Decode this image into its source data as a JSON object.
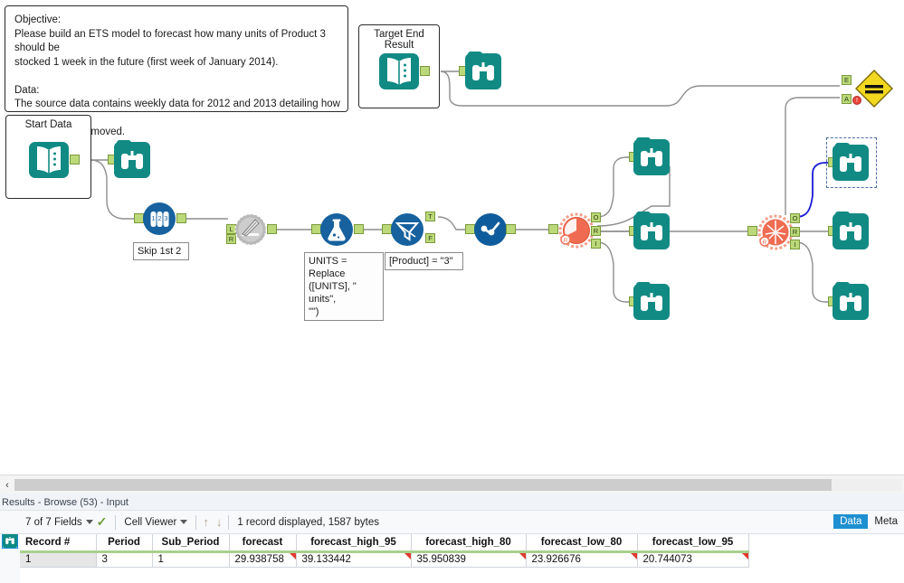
{
  "canvas": {
    "objective_box": {
      "name": "objective-comment",
      "text": "Objective:\nPlease build an ETS model to forecast how many units of Product 3 should be\nstocked 1 week in the future (first week of January 2014).\n\nData:\nThe source data contains weekly data for 2012 and 2013 detailing how many\nunits have been moved."
    },
    "target_box": {
      "title": "Target End Result"
    },
    "start_box": {
      "title": "Start Data"
    },
    "annotations": {
      "skip": "Skip 1st 2",
      "formula": "UNITS = Replace\n([UNITS], \" units\",\n\"\")",
      "filter": "[Product] = \"3\""
    },
    "anchors": {
      "left": "L",
      "right": "R",
      "true": "T",
      "false": "F",
      "out": "O",
      "report": "R",
      "interactive": "I",
      "expected": "E",
      "actual": "A",
      "error": "!"
    },
    "tools": [
      {
        "name": "input-data-target",
        "type": "input"
      },
      {
        "name": "browse-target",
        "type": "browse"
      },
      {
        "name": "input-data-start",
        "type": "input"
      },
      {
        "name": "browse-start",
        "type": "browse"
      },
      {
        "name": "sample-tool",
        "type": "sample"
      },
      {
        "name": "join-tool",
        "type": "join"
      },
      {
        "name": "formula-tool",
        "type": "formula"
      },
      {
        "name": "filter-tool",
        "type": "filter"
      },
      {
        "name": "select-tool",
        "type": "select"
      },
      {
        "name": "ets-tool-1",
        "type": "ets"
      },
      {
        "name": "ets-tool-2",
        "type": "ets"
      },
      {
        "name": "union-diamond-tool",
        "type": "diamond"
      }
    ]
  },
  "hscroll": {
    "left_arrow": "‹"
  },
  "results": {
    "title": "Results - Browse (53) - Input",
    "toolbar": {
      "fields": "7 of 7 Fields",
      "cell_viewer": "Cell Viewer",
      "up_arrow": "↑",
      "down_arrow": "↓",
      "status": "1 record displayed, 1587 bytes"
    },
    "tabs": [
      {
        "label": "Data",
        "active": true
      },
      {
        "label": "Meta",
        "active": false
      }
    ],
    "columns": [
      "Record #",
      "Period",
      "Sub_Period",
      "forecast",
      "forecast_high_95",
      "forecast_high_80",
      "forecast_low_80",
      "forecast_low_95"
    ],
    "rows": [
      [
        "1",
        "3",
        "1",
        "29.938758",
        "39.133442",
        "35.950839",
        "23.926676",
        "20.744073"
      ]
    ]
  },
  "colors": {
    "teal": "#118a84",
    "blue_tool": "#16619e",
    "ets_red": "#ef6c52",
    "anchor_green": "#bcd97a",
    "diamond_yellow": "#f2d81f",
    "selection_blue": "#4a6fa5",
    "tab_active": "#1e8fd1",
    "header_underline": "#a9d18e"
  }
}
